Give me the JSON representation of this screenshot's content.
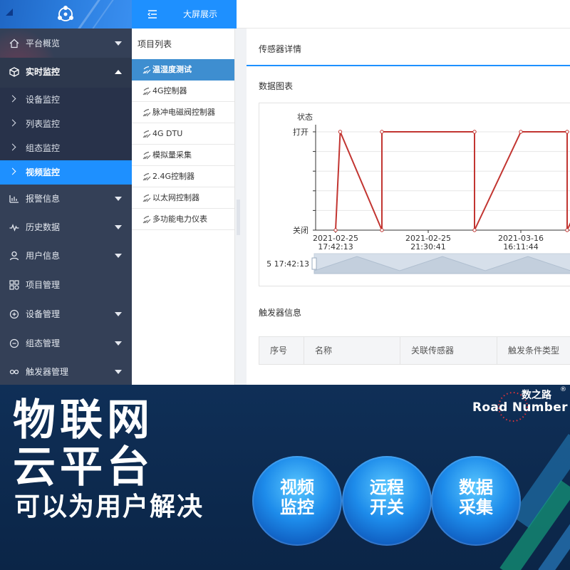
{
  "sidebar": {
    "menu": [
      {
        "label": "平台概览",
        "icon": "home-icon"
      },
      {
        "label": "实时监控",
        "icon": "cube-icon"
      },
      {
        "label": "报警信息",
        "icon": "alarm-icon"
      },
      {
        "label": "历史数据",
        "icon": "pulse-icon"
      },
      {
        "label": "用户信息",
        "icon": "user-icon"
      },
      {
        "label": "项目管理",
        "icon": "grid-icon"
      },
      {
        "label": "设备管理",
        "icon": "device-icon"
      },
      {
        "label": "组态管理",
        "icon": "config-icon"
      },
      {
        "label": "触发器管理",
        "icon": "link-icon"
      }
    ],
    "submenu": [
      {
        "label": "设备监控"
      },
      {
        "label": "列表监控"
      },
      {
        "label": "组态监控"
      },
      {
        "label": "视频监控"
      }
    ],
    "selected_submenu": "视频监控"
  },
  "topbar": {
    "title": "大屏展示"
  },
  "project_list": {
    "title": "项目列表",
    "items": [
      {
        "label": "温湿度测试"
      },
      {
        "label": "4G控制器"
      },
      {
        "label": "脉冲电磁阀控制器"
      },
      {
        "label": "4G DTU"
      },
      {
        "label": "模拟量采集"
      },
      {
        "label": "2.4G控制器"
      },
      {
        "label": "以太网控制器"
      },
      {
        "label": "多功能电力仪表"
      }
    ],
    "selected": "温湿度测试"
  },
  "detail": {
    "title": "传感器详情",
    "chart_title": "数据图表",
    "trigger_title": "触发器信息",
    "trigger_columns": [
      "序号",
      "名称",
      "关联传感器",
      "触发条件类型"
    ]
  },
  "chart_data": {
    "type": "line",
    "ylabel": "状态",
    "y_categories": [
      "关闭",
      "打开"
    ],
    "x_tick_labels": [
      {
        "date": "2021-02-25",
        "time": "17:42:13"
      },
      {
        "date": "2021-02-25",
        "time": "21:30:41"
      },
      {
        "date": "2021-03-16",
        "time": "16:11:44"
      }
    ],
    "series": [
      {
        "color": "#c23531",
        "step_values": [
          0,
          1,
          0,
          1,
          1,
          0,
          1,
          1,
          0,
          1
        ],
        "points_index": [
          0,
          0.05,
          0.5,
          0.5,
          1.5,
          1.5,
          2,
          2.5,
          2.5,
          3
        ]
      }
    ],
    "zoom_label": "5 17:42:13",
    "grid": true
  },
  "banner": {
    "headline_line1": "物联网",
    "headline_line2": "云平台",
    "subline": "可以为用户解决",
    "brand_cn": "数之路",
    "brand_en": "Road Number",
    "brand_reg": "®",
    "bubbles": [
      {
        "line1": "视频",
        "line2": "监控"
      },
      {
        "line1": "远程",
        "line2": "开关"
      },
      {
        "line1": "数据",
        "line2": "采集"
      }
    ]
  },
  "colors": {
    "sidebar_bg": "#344057",
    "accent": "#1e90ff",
    "chart_line": "#c23531",
    "banner_bg": "#0f2f57"
  }
}
